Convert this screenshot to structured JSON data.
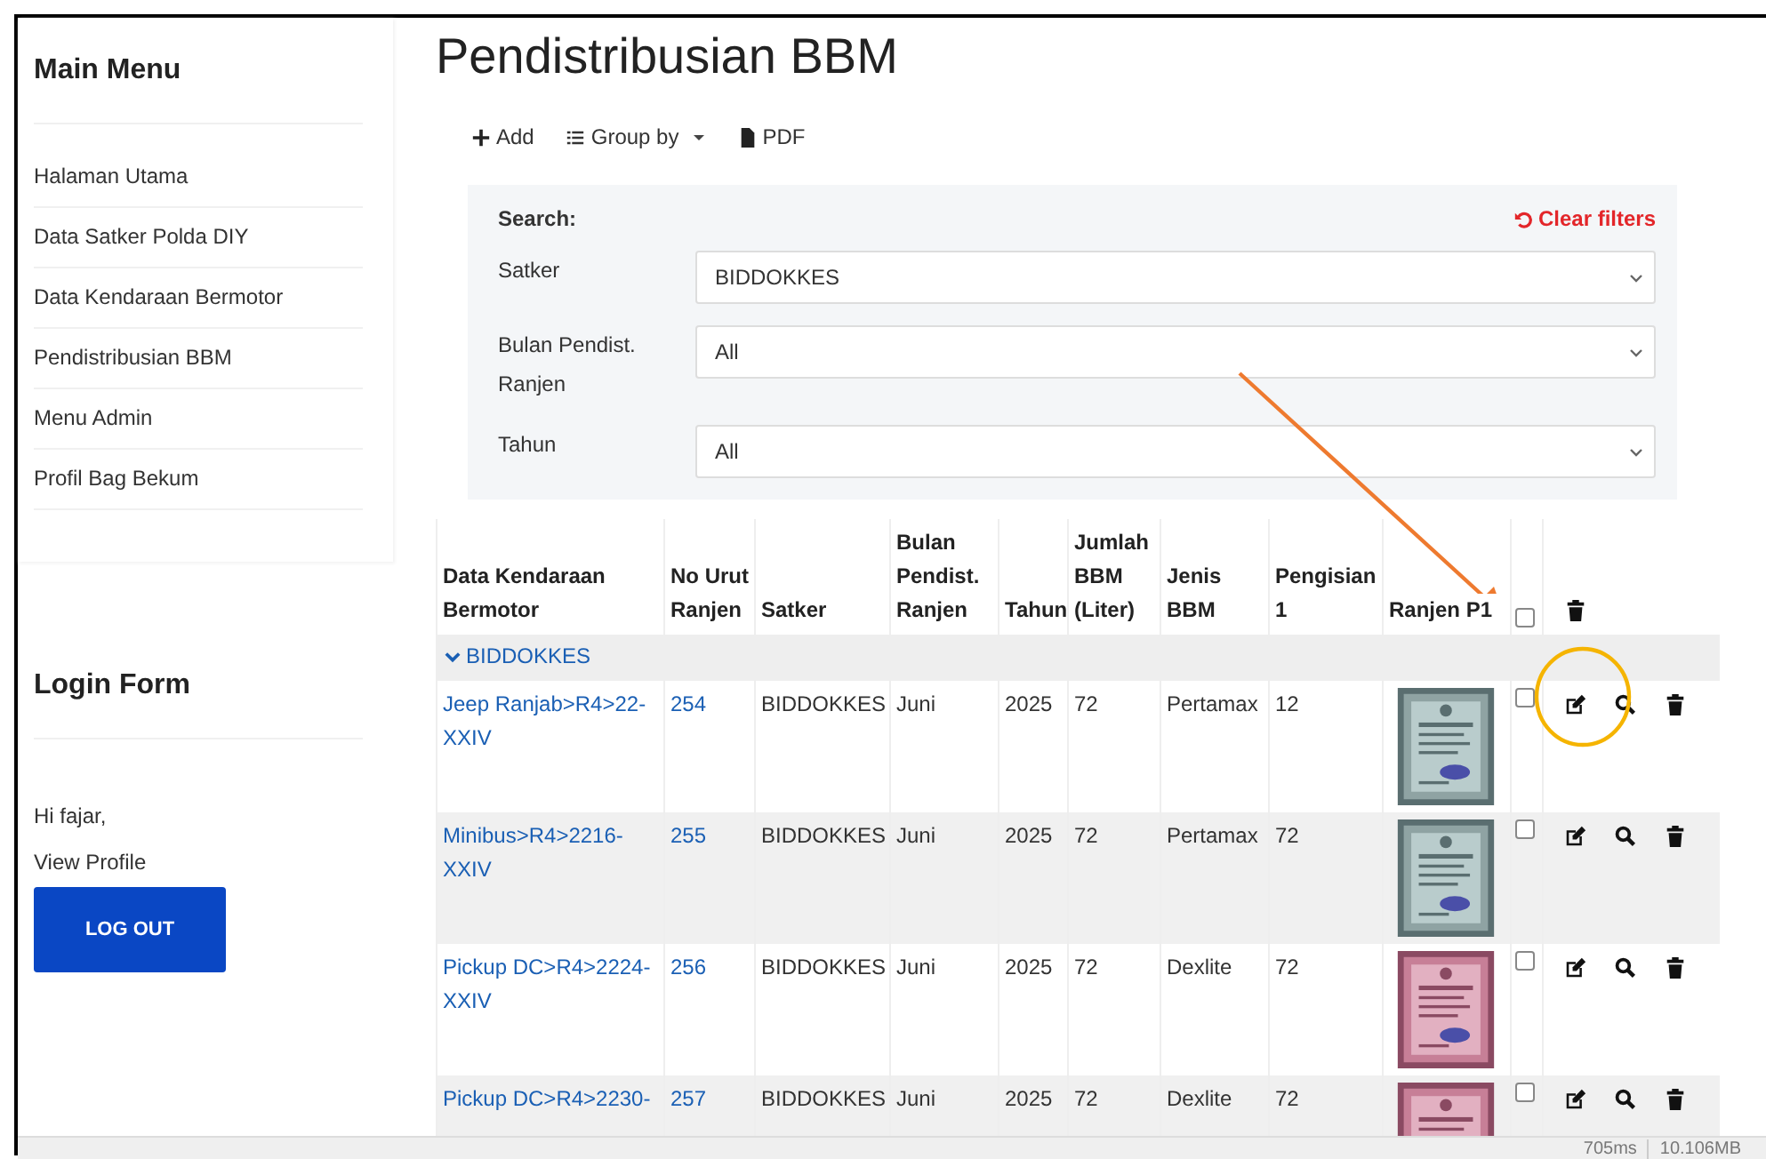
{
  "sidebar": {
    "main_menu": {
      "title": "Main Menu",
      "items": [
        {
          "label": "Halaman Utama"
        },
        {
          "label": "Data Satker Polda DIY"
        },
        {
          "label": "Data Kendaraan Bermotor"
        },
        {
          "label": "Pendistribusian BBM"
        },
        {
          "label": "Menu Admin"
        },
        {
          "label": "Profil Bag Bekum"
        }
      ]
    },
    "login_form": {
      "title": "Login Form",
      "greeting": "Hi fajar,",
      "profile_link": "View Profile",
      "logout_button": "LOG OUT"
    }
  },
  "page": {
    "title": "Pendistribusian BBM",
    "toolbar": [
      {
        "kind": "add",
        "label": "Add"
      },
      {
        "kind": "group",
        "label": "Group by"
      },
      {
        "kind": "pdf",
        "label": "PDF"
      }
    ]
  },
  "search": {
    "title": "Search:",
    "clear": "Clear filters",
    "filters": [
      {
        "label": "Satker",
        "value": "BIDDOKKES"
      },
      {
        "label": "Bulan Pendist. Ranjen",
        "value": "All"
      },
      {
        "label": "Tahun",
        "value": "All"
      }
    ]
  },
  "table": {
    "columns": [
      "Data Kendaraan Bermotor",
      "No Urut Ranjen",
      "Satker",
      "Bulan Pendist. Ranjen",
      "Tahun",
      "Jumlah BBM (Liter)",
      "Jenis BBM",
      "Pengisian 1",
      "Ranjen P1"
    ],
    "select_all": {
      "checked": false
    },
    "group": {
      "label": "BIDDOKKES",
      "expanded": true
    },
    "rows": [
      {
        "vehicle": "Jeep Ranjab>R4>22-XXIV",
        "no": "254",
        "satker": "BIDDOKKES",
        "bulan": "Juni",
        "tahun": "2025",
        "jumlah": "72",
        "jenis": "Pertamax",
        "pengisian": "12",
        "checked": false
      },
      {
        "vehicle": "Minibus>R4>2216-XXIV",
        "no": "255",
        "satker": "BIDDOKKES",
        "bulan": "Juni",
        "tahun": "2025",
        "jumlah": "72",
        "jenis": "Pertamax",
        "pengisian": "72",
        "checked": false
      },
      {
        "vehicle": "Pickup DC>R4>2224-XXIV",
        "no": "256",
        "satker": "BIDDOKKES",
        "bulan": "Juni",
        "tahun": "2025",
        "jumlah": "72",
        "jenis": "Dexlite",
        "pengisian": "72",
        "checked": false
      },
      {
        "vehicle": "Pickup DC>R4>2230-",
        "no": "257",
        "satker": "BIDDOKKES",
        "bulan": "Juni",
        "tahun": "2025",
        "jumlah": "72",
        "jenis": "Dexlite",
        "pengisian": "72",
        "checked": false
      }
    ]
  },
  "status_bar": {
    "time": "705ms",
    "memory": "10.106MB"
  }
}
